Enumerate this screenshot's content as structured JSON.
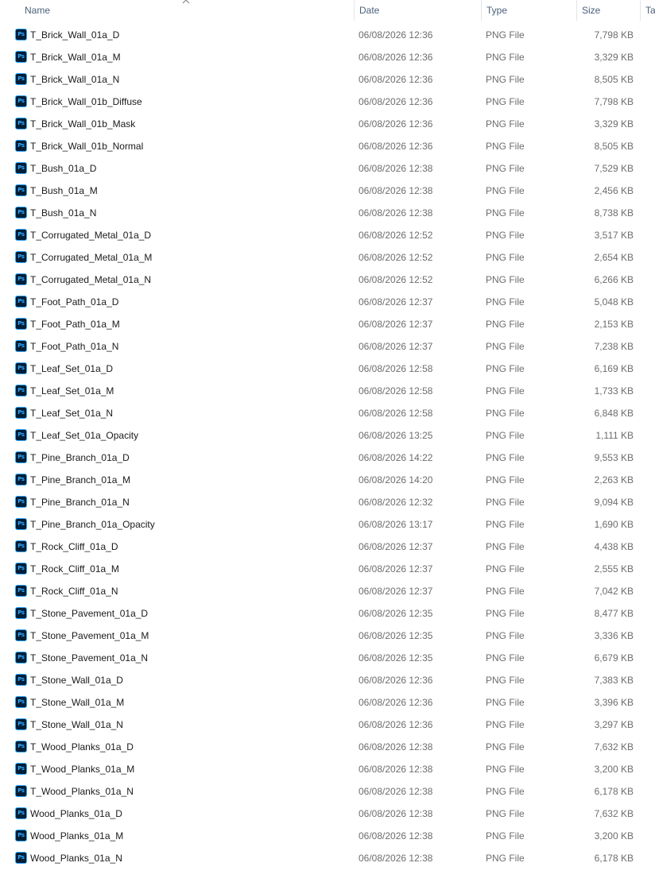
{
  "columns": {
    "name": "Name",
    "date": "Date",
    "type": "Type",
    "size": "Size",
    "tags": "Ta"
  },
  "colors": {
    "header_text": "#4c607a",
    "ps_icon_bg": "#001e36",
    "ps_icon_fg": "#31a8ff"
  },
  "sort": {
    "column": "name",
    "direction": "ascending",
    "icon": "sort-up-icon"
  },
  "icon_label": "Ps",
  "files": [
    {
      "name": "T_Brick_Wall_01a_D",
      "date": "06/08/2026 12:36",
      "type": "PNG File",
      "size": "7,798 KB"
    },
    {
      "name": "T_Brick_Wall_01a_M",
      "date": "06/08/2026 12:36",
      "type": "PNG File",
      "size": "3,329 KB"
    },
    {
      "name": "T_Brick_Wall_01a_N",
      "date": "06/08/2026 12:36",
      "type": "PNG File",
      "size": "8,505 KB"
    },
    {
      "name": "T_Brick_Wall_01b_Diffuse",
      "date": "06/08/2026 12:36",
      "type": "PNG File",
      "size": "7,798 KB"
    },
    {
      "name": "T_Brick_Wall_01b_Mask",
      "date": "06/08/2026 12:36",
      "type": "PNG File",
      "size": "3,329 KB"
    },
    {
      "name": "T_Brick_Wall_01b_Normal",
      "date": "06/08/2026 12:36",
      "type": "PNG File",
      "size": "8,505 KB"
    },
    {
      "name": "T_Bush_01a_D",
      "date": "06/08/2026 12:38",
      "type": "PNG File",
      "size": "7,529 KB"
    },
    {
      "name": "T_Bush_01a_M",
      "date": "06/08/2026 12:38",
      "type": "PNG File",
      "size": "2,456 KB"
    },
    {
      "name": "T_Bush_01a_N",
      "date": "06/08/2026 12:38",
      "type": "PNG File",
      "size": "8,738 KB"
    },
    {
      "name": "T_Corrugated_Metal_01a_D",
      "date": "06/08/2026 12:52",
      "type": "PNG File",
      "size": "3,517 KB"
    },
    {
      "name": "T_Corrugated_Metal_01a_M",
      "date": "06/08/2026 12:52",
      "type": "PNG File",
      "size": "2,654 KB"
    },
    {
      "name": "T_Corrugated_Metal_01a_N",
      "date": "06/08/2026 12:52",
      "type": "PNG File",
      "size": "6,266 KB"
    },
    {
      "name": "T_Foot_Path_01a_D",
      "date": "06/08/2026 12:37",
      "type": "PNG File",
      "size": "5,048 KB"
    },
    {
      "name": "T_Foot_Path_01a_M",
      "date": "06/08/2026 12:37",
      "type": "PNG File",
      "size": "2,153 KB"
    },
    {
      "name": "T_Foot_Path_01a_N",
      "date": "06/08/2026 12:37",
      "type": "PNG File",
      "size": "7,238 KB"
    },
    {
      "name": "T_Leaf_Set_01a_D",
      "date": "06/08/2026 12:58",
      "type": "PNG File",
      "size": "6,169 KB"
    },
    {
      "name": "T_Leaf_Set_01a_M",
      "date": "06/08/2026 12:58",
      "type": "PNG File",
      "size": "1,733 KB"
    },
    {
      "name": "T_Leaf_Set_01a_N",
      "date": "06/08/2026 12:58",
      "type": "PNG File",
      "size": "6,848 KB"
    },
    {
      "name": "T_Leaf_Set_01a_Opacity",
      "date": "06/08/2026 13:25",
      "type": "PNG File",
      "size": "1,111 KB"
    },
    {
      "name": "T_Pine_Branch_01a_D",
      "date": "06/08/2026 14:22",
      "type": "PNG File",
      "size": "9,553 KB"
    },
    {
      "name": "T_Pine_Branch_01a_M",
      "date": "06/08/2026 14:20",
      "type": "PNG File",
      "size": "2,263 KB"
    },
    {
      "name": "T_Pine_Branch_01a_N",
      "date": "06/08/2026 12:32",
      "type": "PNG File",
      "size": "9,094 KB"
    },
    {
      "name": "T_Pine_Branch_01a_Opacity",
      "date": "06/08/2026 13:17",
      "type": "PNG File",
      "size": "1,690 KB"
    },
    {
      "name": "T_Rock_Cliff_01a_D",
      "date": "06/08/2026 12:37",
      "type": "PNG File",
      "size": "4,438 KB"
    },
    {
      "name": "T_Rock_Cliff_01a_M",
      "date": "06/08/2026 12:37",
      "type": "PNG File",
      "size": "2,555 KB"
    },
    {
      "name": "T_Rock_Cliff_01a_N",
      "date": "06/08/2026 12:37",
      "type": "PNG File",
      "size": "7,042 KB"
    },
    {
      "name": "T_Stone_Pavement_01a_D",
      "date": "06/08/2026 12:35",
      "type": "PNG File",
      "size": "8,477 KB"
    },
    {
      "name": "T_Stone_Pavement_01a_M",
      "date": "06/08/2026 12:35",
      "type": "PNG File",
      "size": "3,336 KB"
    },
    {
      "name": "T_Stone_Pavement_01a_N",
      "date": "06/08/2026 12:35",
      "type": "PNG File",
      "size": "6,679 KB"
    },
    {
      "name": "T_Stone_Wall_01a_D",
      "date": "06/08/2026 12:36",
      "type": "PNG File",
      "size": "7,383 KB"
    },
    {
      "name": "T_Stone_Wall_01a_M",
      "date": "06/08/2026 12:36",
      "type": "PNG File",
      "size": "3,396 KB"
    },
    {
      "name": "T_Stone_Wall_01a_N",
      "date": "06/08/2026 12:36",
      "type": "PNG File",
      "size": "3,297 KB"
    },
    {
      "name": "T_Wood_Planks_01a_D",
      "date": "06/08/2026 12:38",
      "type": "PNG File",
      "size": "7,632 KB"
    },
    {
      "name": "T_Wood_Planks_01a_M",
      "date": "06/08/2026 12:38",
      "type": "PNG File",
      "size": "3,200 KB"
    },
    {
      "name": "T_Wood_Planks_01a_N",
      "date": "06/08/2026 12:38",
      "type": "PNG File",
      "size": "6,178 KB"
    },
    {
      "name": "Wood_Planks_01a_D",
      "date": "06/08/2026 12:38",
      "type": "PNG File",
      "size": "7,632 KB"
    },
    {
      "name": "Wood_Planks_01a_M",
      "date": "06/08/2026 12:38",
      "type": "PNG File",
      "size": "3,200 KB"
    },
    {
      "name": "Wood_Planks_01a_N",
      "date": "06/08/2026 12:38",
      "type": "PNG File",
      "size": "6,178 KB"
    }
  ]
}
